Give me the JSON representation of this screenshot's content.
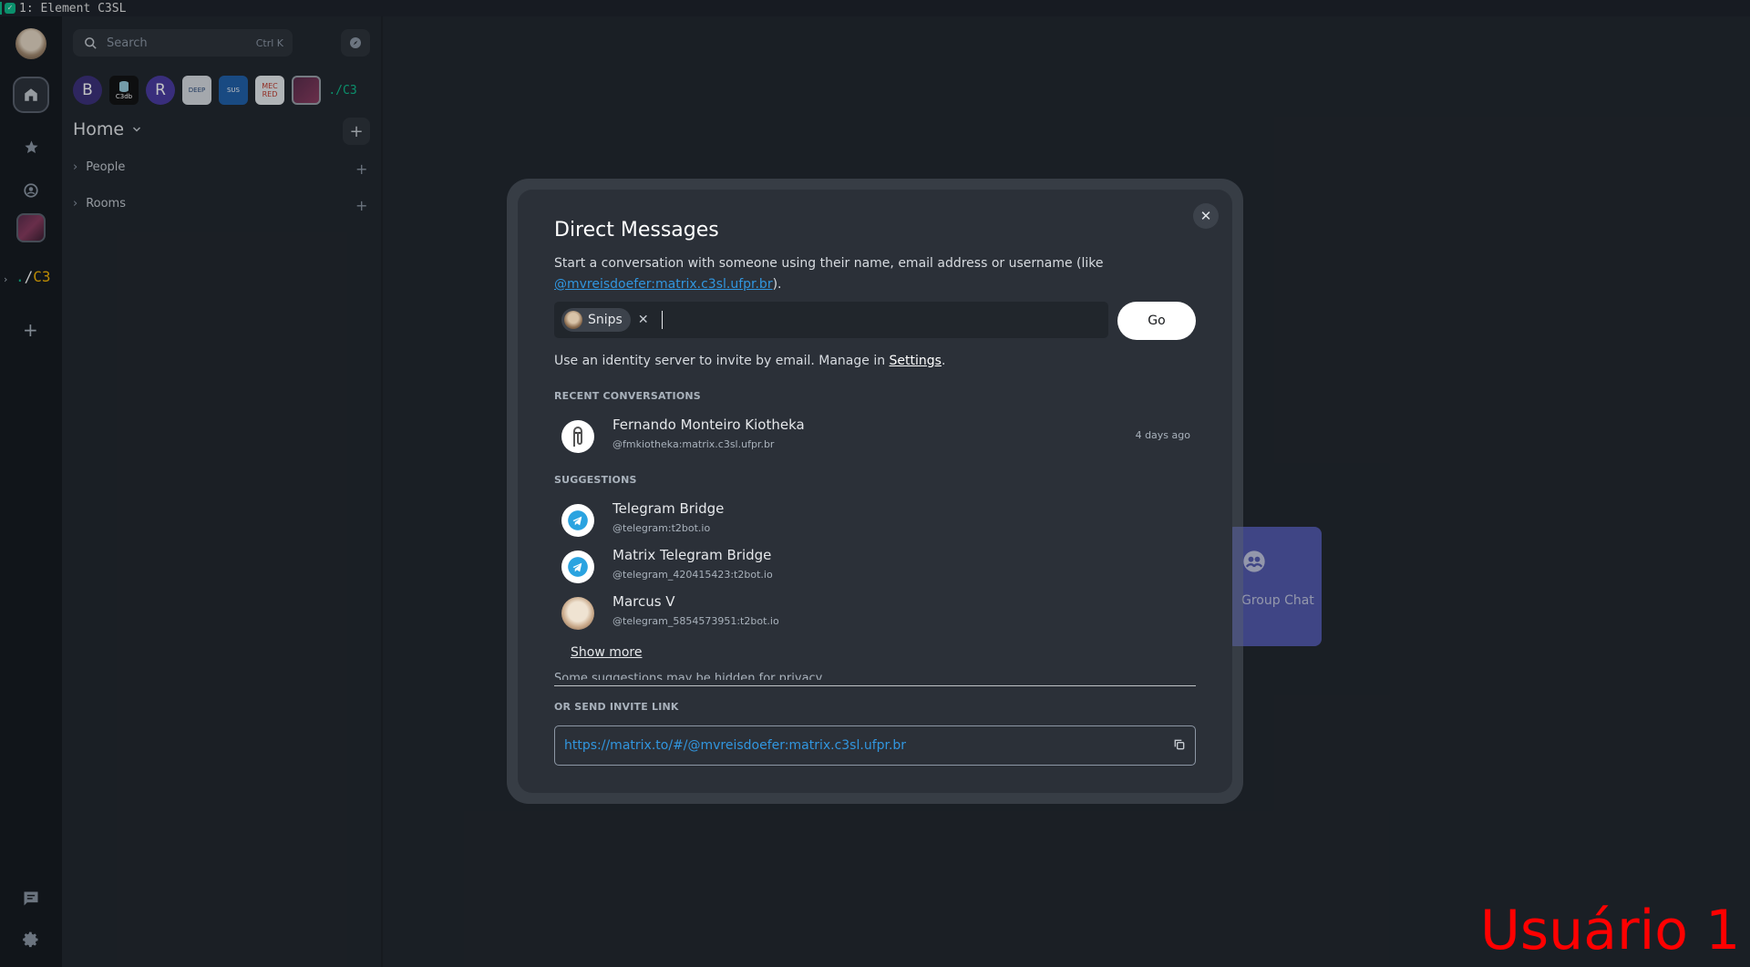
{
  "window": {
    "title": "1: Element C3SL"
  },
  "spacebar": {
    "spaces": [
      {
        "name": "Home",
        "icon": "home-icon"
      },
      {
        "name": "Favourites",
        "icon": "star-icon"
      },
      {
        "name": "People",
        "icon": "person-circle-icon"
      },
      {
        "name": "C3 image space",
        "icon": "space-image"
      },
      {
        "name": "./c3",
        "text": "./C3"
      }
    ],
    "c3_text": "./C3",
    "bottom": [
      "threads-icon",
      "settings-gear-icon"
    ]
  },
  "roomlist": {
    "search_placeholder": "Search",
    "search_shortcut": "Ctrl K",
    "space_badges": [
      "B",
      "C3db",
      "R",
      "DEEP",
      "SUS",
      "MEC RED",
      "",
      "./C3"
    ],
    "home_title": "Home",
    "sections": [
      {
        "label": "People"
      },
      {
        "label": "Rooms"
      }
    ]
  },
  "background": {
    "group_chat_label": "Group Chat"
  },
  "dialog": {
    "title": "Direct Messages",
    "description_prefix": "Start a conversation with someone using their name, email address or username (like",
    "example_user": "@mvreisdoefer:matrix.c3sl.ufpr.br",
    "description_suffix": ").",
    "selected_pill": "Snips",
    "go_label": "Go",
    "identity_text": "Use an identity server to invite by email. Manage in",
    "identity_link": "Settings",
    "identity_end": ".",
    "recent_header": "RECENT CONVERSATIONS",
    "recent": [
      {
        "name": "Fernando Monteiro Kiotheka",
        "mxid": "@fmkiotheka:matrix.c3sl.ufpr.br",
        "time": "4 days ago"
      }
    ],
    "suggestions_header": "SUGGESTIONS",
    "suggestions": [
      {
        "name": "Telegram Bridge",
        "mxid": "@telegram:t2bot.io"
      },
      {
        "name": "Matrix Telegram Bridge",
        "mxid": "@telegram_420415423:t2bot.io"
      },
      {
        "name": "Marcus V",
        "mxid": "@telegram_5854573951:t2bot.io"
      }
    ],
    "show_more": "Show more",
    "hidden_note": "Some suggestions may be hidden for privacy.",
    "invite_header": "OR SEND INVITE LINK",
    "invite_url": "https://matrix.to/#/@mvreisdoefer:matrix.c3sl.ufpr.br"
  },
  "overlay_label": "Usuário 1",
  "colors": {
    "accent": "#0dbd8b",
    "link": "#3196df",
    "background": "#21262c",
    "dialog": "#2b3038"
  }
}
